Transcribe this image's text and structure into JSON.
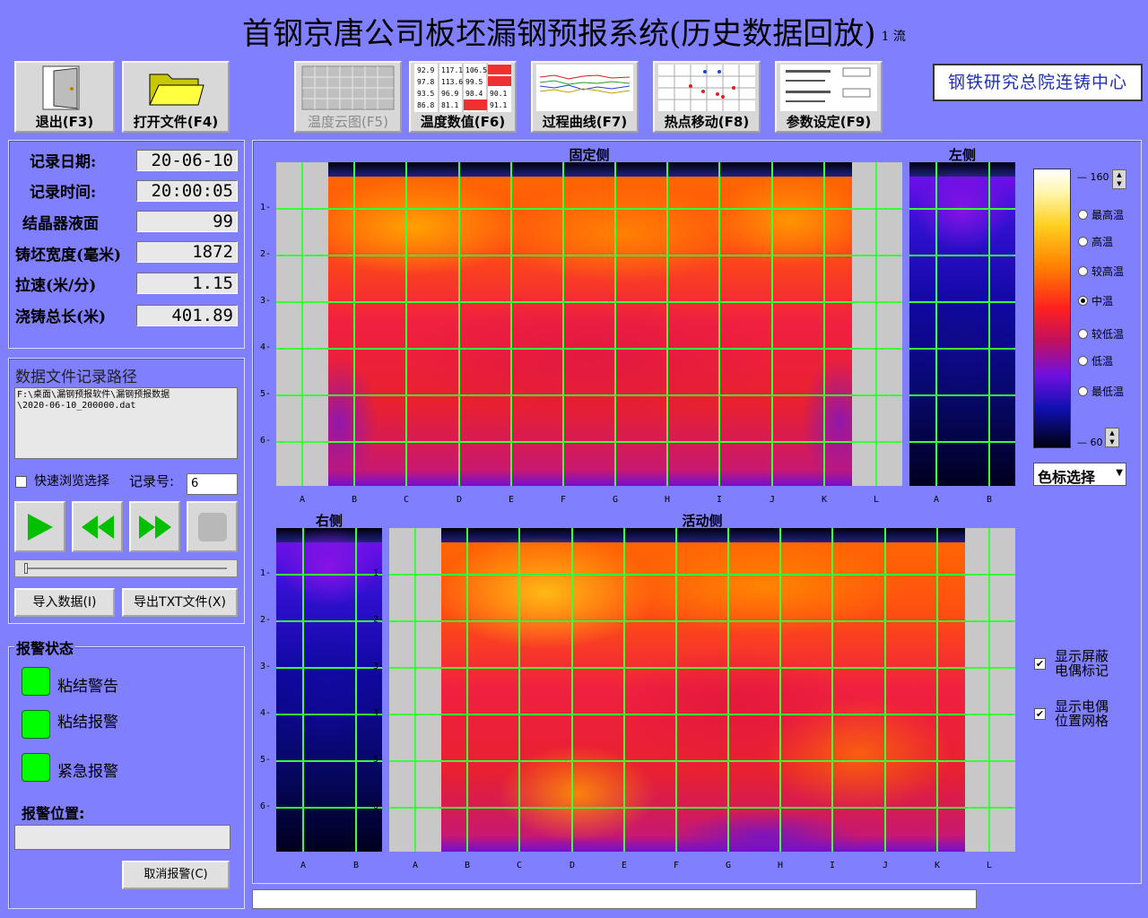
{
  "header": {
    "title": "首钢京唐公司板坯漏钢预报系统(历史数据回放)",
    "strand": "1 流",
    "logo_text": "钢铁研究总院连铸中心"
  },
  "toolbar": {
    "exit": "退出(F3)",
    "open": "打开文件(F4)",
    "temp_cloud": "温度云图(F5)",
    "temp_values": "温度数值(F6)",
    "process_curve": "过程曲线(F7)",
    "hotspot": "热点移动(F8)",
    "params": "参数设定(F9)"
  },
  "record": {
    "date_label": "记录日期:",
    "date": "20-06-10",
    "time_label": "记录时间:",
    "time": "20:00:05",
    "level_label": "结晶器液面",
    "level": "99",
    "width_label": "铸坯宽度(毫米)",
    "width": "1872",
    "speed_label": "拉速(米/分)",
    "speed": "1.15",
    "length_label": "浇铸总长(米)",
    "length": "401.89"
  },
  "file": {
    "path_label": "数据文件记录路径",
    "path_value": "F:\\桌面\\漏钢预报软件\\漏钢预报数据\n\\2020-06-10_200000.dat",
    "quick_browse": "快速浏览选择",
    "record_no_label": "记录号:",
    "record_no": "6",
    "import_btn": "导入数据(I)",
    "export_btn": "导出TXT文件(X)"
  },
  "alarm": {
    "title": "报警状态",
    "stick_warn": "粘结警告",
    "stick_alarm": "粘结报警",
    "emergency": "紧急报警",
    "position_label": "报警位置:",
    "cancel_btn": "取消报警(C)"
  },
  "plots": {
    "fixed": "固定侧",
    "left": "左侧",
    "right": "右侧",
    "active": "活动侧",
    "rows": [
      "1",
      "2",
      "3",
      "4",
      "5",
      "6"
    ],
    "wide_cols": [
      "A",
      "B",
      "C",
      "D",
      "E",
      "F",
      "G",
      "H",
      "I",
      "J",
      "K",
      "L"
    ],
    "narrow_cols": [
      "A",
      "B"
    ]
  },
  "colorbar": {
    "max": "160",
    "min": "60",
    "levels": [
      "最高温",
      "高温",
      "较高温",
      "中温",
      "较低温",
      "低温",
      "最低温"
    ],
    "selected": "中温",
    "select_btn": "色标选择"
  },
  "options": {
    "show_shield": "显示屏蔽\n电偶标记",
    "show_grid": "显示电偶\n位置网格"
  },
  "colors": {
    "background": "#8080ff",
    "grid": "#38ff38",
    "led": "#00ff00"
  }
}
